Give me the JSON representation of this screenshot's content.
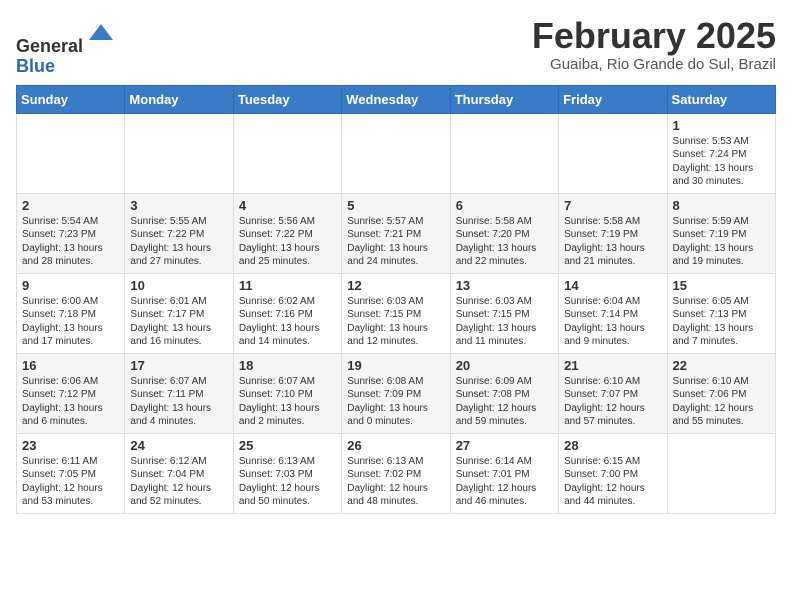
{
  "header": {
    "logo_line1": "General",
    "logo_line2": "Blue",
    "month_title": "February 2025",
    "location": "Guaiba, Rio Grande do Sul, Brazil"
  },
  "days_of_week": [
    "Sunday",
    "Monday",
    "Tuesday",
    "Wednesday",
    "Thursday",
    "Friday",
    "Saturday"
  ],
  "weeks": [
    [
      {
        "day": "",
        "info": ""
      },
      {
        "day": "",
        "info": ""
      },
      {
        "day": "",
        "info": ""
      },
      {
        "day": "",
        "info": ""
      },
      {
        "day": "",
        "info": ""
      },
      {
        "day": "",
        "info": ""
      },
      {
        "day": "1",
        "info": "Sunrise: 5:53 AM\nSunset: 7:24 PM\nDaylight: 13 hours\nand 30 minutes."
      }
    ],
    [
      {
        "day": "2",
        "info": "Sunrise: 5:54 AM\nSunset: 7:23 PM\nDaylight: 13 hours\nand 28 minutes."
      },
      {
        "day": "3",
        "info": "Sunrise: 5:55 AM\nSunset: 7:22 PM\nDaylight: 13 hours\nand 27 minutes."
      },
      {
        "day": "4",
        "info": "Sunrise: 5:56 AM\nSunset: 7:22 PM\nDaylight: 13 hours\nand 25 minutes."
      },
      {
        "day": "5",
        "info": "Sunrise: 5:57 AM\nSunset: 7:21 PM\nDaylight: 13 hours\nand 24 minutes."
      },
      {
        "day": "6",
        "info": "Sunrise: 5:58 AM\nSunset: 7:20 PM\nDaylight: 13 hours\nand 22 minutes."
      },
      {
        "day": "7",
        "info": "Sunrise: 5:58 AM\nSunset: 7:19 PM\nDaylight: 13 hours\nand 21 minutes."
      },
      {
        "day": "8",
        "info": "Sunrise: 5:59 AM\nSunset: 7:19 PM\nDaylight: 13 hours\nand 19 minutes."
      }
    ],
    [
      {
        "day": "9",
        "info": "Sunrise: 6:00 AM\nSunset: 7:18 PM\nDaylight: 13 hours\nand 17 minutes."
      },
      {
        "day": "10",
        "info": "Sunrise: 6:01 AM\nSunset: 7:17 PM\nDaylight: 13 hours\nand 16 minutes."
      },
      {
        "day": "11",
        "info": "Sunrise: 6:02 AM\nSunset: 7:16 PM\nDaylight: 13 hours\nand 14 minutes."
      },
      {
        "day": "12",
        "info": "Sunrise: 6:03 AM\nSunset: 7:15 PM\nDaylight: 13 hours\nand 12 minutes."
      },
      {
        "day": "13",
        "info": "Sunrise: 6:03 AM\nSunset: 7:15 PM\nDaylight: 13 hours\nand 11 minutes."
      },
      {
        "day": "14",
        "info": "Sunrise: 6:04 AM\nSunset: 7:14 PM\nDaylight: 13 hours\nand 9 minutes."
      },
      {
        "day": "15",
        "info": "Sunrise: 6:05 AM\nSunset: 7:13 PM\nDaylight: 13 hours\nand 7 minutes."
      }
    ],
    [
      {
        "day": "16",
        "info": "Sunrise: 6:06 AM\nSunset: 7:12 PM\nDaylight: 13 hours\nand 6 minutes."
      },
      {
        "day": "17",
        "info": "Sunrise: 6:07 AM\nSunset: 7:11 PM\nDaylight: 13 hours\nand 4 minutes."
      },
      {
        "day": "18",
        "info": "Sunrise: 6:07 AM\nSunset: 7:10 PM\nDaylight: 13 hours\nand 2 minutes."
      },
      {
        "day": "19",
        "info": "Sunrise: 6:08 AM\nSunset: 7:09 PM\nDaylight: 13 hours\nand 0 minutes."
      },
      {
        "day": "20",
        "info": "Sunrise: 6:09 AM\nSunset: 7:08 PM\nDaylight: 12 hours\nand 59 minutes."
      },
      {
        "day": "21",
        "info": "Sunrise: 6:10 AM\nSunset: 7:07 PM\nDaylight: 12 hours\nand 57 minutes."
      },
      {
        "day": "22",
        "info": "Sunrise: 6:10 AM\nSunset: 7:06 PM\nDaylight: 12 hours\nand 55 minutes."
      }
    ],
    [
      {
        "day": "23",
        "info": "Sunrise: 6:11 AM\nSunset: 7:05 PM\nDaylight: 12 hours\nand 53 minutes."
      },
      {
        "day": "24",
        "info": "Sunrise: 6:12 AM\nSunset: 7:04 PM\nDaylight: 12 hours\nand 52 minutes."
      },
      {
        "day": "25",
        "info": "Sunrise: 6:13 AM\nSunset: 7:03 PM\nDaylight: 12 hours\nand 50 minutes."
      },
      {
        "day": "26",
        "info": "Sunrise: 6:13 AM\nSunset: 7:02 PM\nDaylight: 12 hours\nand 48 minutes."
      },
      {
        "day": "27",
        "info": "Sunrise: 6:14 AM\nSunset: 7:01 PM\nDaylight: 12 hours\nand 46 minutes."
      },
      {
        "day": "28",
        "info": "Sunrise: 6:15 AM\nSunset: 7:00 PM\nDaylight: 12 hours\nand 44 minutes."
      },
      {
        "day": "",
        "info": ""
      }
    ]
  ]
}
